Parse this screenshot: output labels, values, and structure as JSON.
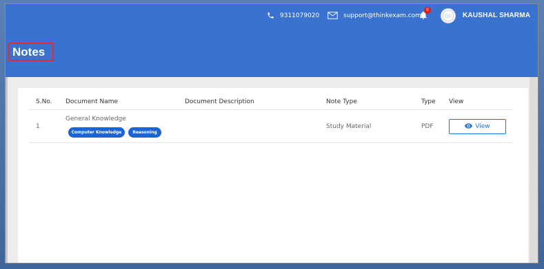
{
  "header": {
    "phone": "9311079020",
    "email": "support@thinkexam.com",
    "notification_count": "0",
    "user_name": "KAUSHAL SHARMA",
    "accent_color": "#3a72d0"
  },
  "page": {
    "title": "Notes"
  },
  "table": {
    "columns": [
      "S.No.",
      "Document Name",
      "Document Description",
      "Note Type",
      "Type",
      "View"
    ],
    "rows": [
      {
        "sno": "1",
        "document_name": "General Knowledge",
        "tags": [
          "Computer Knowledge",
          "Reasoning"
        ],
        "document_description": "",
        "note_type": "Study Material",
        "type": "PDF",
        "view_label": "View"
      }
    ]
  }
}
